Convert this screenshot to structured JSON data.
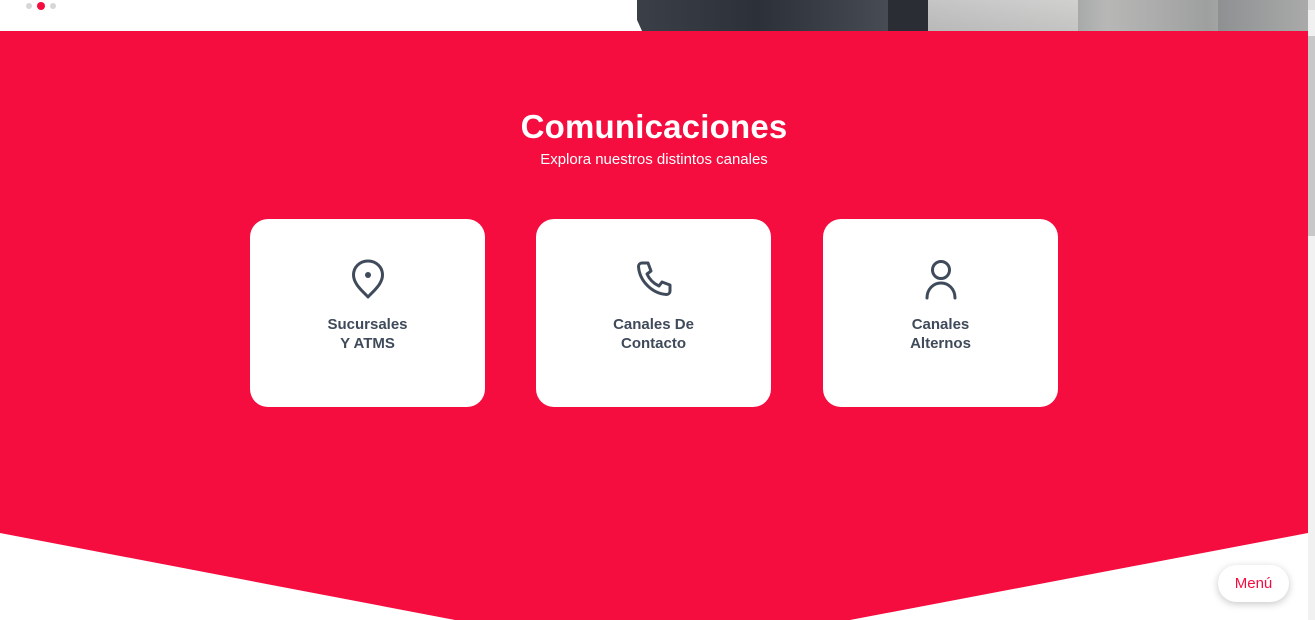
{
  "colors": {
    "brand_red": "#f50d40",
    "card_text": "#3f4a5a",
    "white": "#ffffff"
  },
  "carousel": {
    "dots": [
      {
        "active": false
      },
      {
        "active": true
      },
      {
        "active": false
      }
    ]
  },
  "section": {
    "title": "Comunicaciones",
    "subtitle": "Explora nuestros distintos canales"
  },
  "cards": [
    {
      "icon": "location-pin-icon",
      "line1": "Sucursales",
      "line2": "Y ATMS"
    },
    {
      "icon": "phone-icon",
      "line1": "Canales De",
      "line2": "Contacto"
    },
    {
      "icon": "user-icon",
      "line1": "Canales",
      "line2": "Alternos"
    }
  ],
  "menu_button": {
    "label": "Menú"
  }
}
